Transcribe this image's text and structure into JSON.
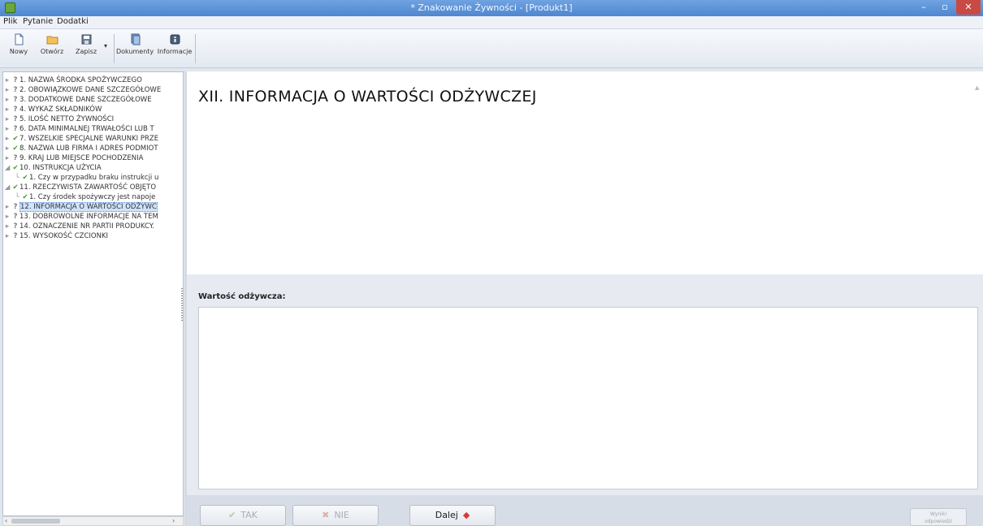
{
  "window": {
    "title": "* Znakowanie Żywności - [Produkt1]",
    "minimize": "–",
    "maximize": "▫",
    "close": "✕"
  },
  "menu": [
    "Plik",
    "Pytanie",
    "Dodatki"
  ],
  "toolbar": {
    "buttons": [
      {
        "label": "Nowy",
        "icon": "new-document-icon"
      },
      {
        "label": "Otwórz",
        "icon": "open-folder-icon"
      },
      {
        "label": "Zapisz",
        "icon": "save-icon"
      },
      {
        "label": "Dokumenty",
        "icon": "documents-icon"
      },
      {
        "label": "Informacje",
        "icon": "info-icon"
      }
    ],
    "dropdown_arrow": "▾"
  },
  "tree": {
    "items": [
      {
        "label": "1. NAZWA ŚRODKA SPOŻYWCZEGO",
        "mark": "?",
        "level": 0
      },
      {
        "label": "2. OBOWIĄZKOWE DANE SZCZEGÓŁOWE",
        "mark": "?",
        "level": 0
      },
      {
        "label": "3. DODATKOWE DANE SZCZEGÓŁOWE",
        "mark": "?",
        "level": 0
      },
      {
        "label": "4. WYKAZ SKŁADNIKÓW",
        "mark": "?",
        "level": 0
      },
      {
        "label": "5. ILOŚĆ NETTO ŻYWNOŚCI",
        "mark": "?",
        "level": 0
      },
      {
        "label": "6. DATA MINIMALNEJ TRWAŁOŚCI LUB T",
        "mark": "?",
        "level": 0
      },
      {
        "label": "7. WSZELKIE SPECJALNE WARUNKI PRZE",
        "mark": "✔",
        "level": 0
      },
      {
        "label": "8. NAZWA LUB FIRMA I ADRES PODMIOT",
        "mark": "✔",
        "level": 0
      },
      {
        "label": "9. KRAJ LUB MIEJSCE POCHODZENIA",
        "mark": "?",
        "level": 0
      },
      {
        "label": "10. INSTRUKCJA UŻYCIA",
        "mark": "✔",
        "level": 0,
        "expanded": true
      },
      {
        "label": "1. Czy w przypadku braku instrukcji u",
        "mark": "✔",
        "level": 1
      },
      {
        "label": "11. RZECZYWISTA ZAWARTOŚĆ OBJĘTO",
        "mark": "✔",
        "level": 0,
        "expanded": true
      },
      {
        "label": "1. Czy środek spożywczy jest napoje",
        "mark": "✔",
        "level": 1
      },
      {
        "label": "12. INFORMACJA O WARTOŚCI ODŻYWC",
        "mark": "?",
        "level": 0,
        "selected": true
      },
      {
        "label": "13. DOBROWOLNE INFORMACJE NA TEM",
        "mark": "?",
        "level": 0
      },
      {
        "label": "14. OZNACZENIE NR PARTII PRODUKCY.",
        "mark": "?",
        "level": 0
      },
      {
        "label": "15. WYSOKOŚĆ CZCIONKI",
        "mark": "?",
        "level": 0
      }
    ],
    "scroll_left": "‹",
    "scroll_right": "›"
  },
  "question": {
    "heading": "XII. INFORMACJA O WARTOŚCI ODŻYWCZEJ"
  },
  "answer": {
    "label": "Wartość odżywcza:",
    "value": ""
  },
  "bottom": {
    "yes_label": "TAK",
    "no_label": "NIE",
    "next_label": "Dalej",
    "yes_symbol": "✔",
    "no_symbol": "✖",
    "next_symbol": "◆",
    "small_button_line1": "Wyniki",
    "small_button_line2": "odpowiedzi"
  },
  "colors": {
    "title_bar": "#5b8fd6",
    "close_button": "#c94a43",
    "selection": "#cfe3fb",
    "check": "#3f9b2f"
  }
}
